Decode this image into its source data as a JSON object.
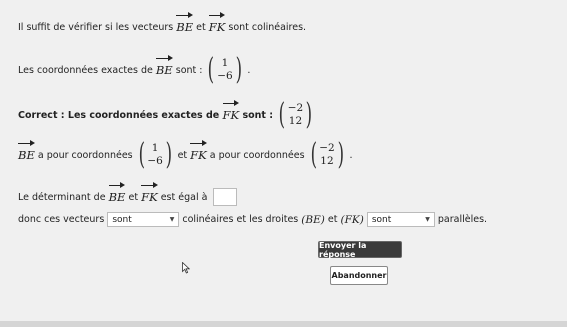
{
  "colors": {
    "background": "#f0f0f0",
    "submit_bg": "#3a3a3a",
    "text": "#222222"
  },
  "line1": {
    "prefix": "Il suffit de vérifier si les vecteurs",
    "v1": "BE",
    "and": "et",
    "v2": "FK",
    "suffix": "sont colinéaires."
  },
  "line2": {
    "prefix": "Les coordonnées exactes de",
    "v1": "BE",
    "suffix": "sont :",
    "col": [
      "1",
      "−6"
    ],
    "end": "."
  },
  "line3": {
    "prefix": "Correct : Les coordonnées exactes de",
    "v1": "FK",
    "suffix": "sont :",
    "col": [
      "−2",
      "12"
    ]
  },
  "line4": {
    "v1": "BE",
    "mid1": "a pour coordonnées",
    "col1": [
      "1",
      "−6"
    ],
    "and": "et",
    "v2": "FK",
    "mid2": "a pour coordonnées",
    "col2": [
      "−2",
      "12"
    ],
    "end": "."
  },
  "line5": {
    "prefix": "Le déterminant de",
    "v1": "BE",
    "and": "et",
    "v2": "FK",
    "suffix": "est égal à",
    "answer": ""
  },
  "line6": {
    "prefix": "donc ces vecteurs",
    "select1": "sont",
    "mid": "colinéaires et les droites",
    "d1": "(BE)",
    "and": "et",
    "d2": "(FK)",
    "select2": "sont",
    "suffix": "parallèles."
  },
  "buttons": {
    "submit": "Envoyer la réponse",
    "abandon": "Abandonner"
  },
  "icons": {
    "dropdown": "chevron-down-icon",
    "cursor": "mouse-pointer-icon"
  }
}
